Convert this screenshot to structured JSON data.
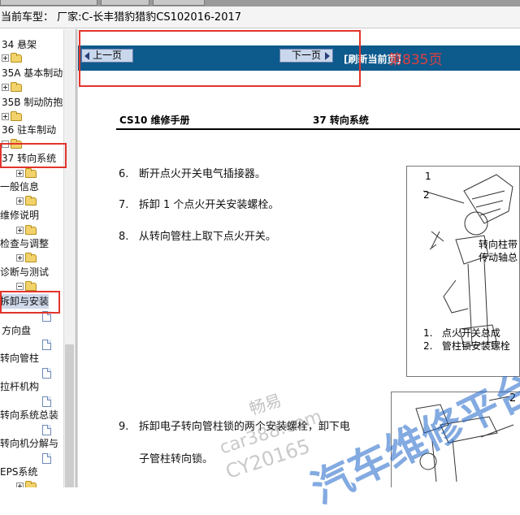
{
  "header": {
    "title": "当前车型： 厂家:C-长丰猎豹猎豹CS102016-2017"
  },
  "toolbar": {
    "prev_label": "上一页",
    "next_label": "下一页",
    "page_info_label": "[刷新当前页]",
    "page_info_value": "第835页"
  },
  "sidebar": {
    "items": [
      {
        "label": "34 悬架",
        "type": "folder"
      },
      {
        "label": "35A 基本制动",
        "type": "folder"
      },
      {
        "label": "35B 制动防抱",
        "type": "folder"
      },
      {
        "label": "36 驻车制动",
        "type": "folder"
      },
      {
        "label": "37 转向系统",
        "type": "folder"
      },
      {
        "label": "一般信息",
        "type": "folder"
      },
      {
        "label": "维修说明",
        "type": "folder"
      },
      {
        "label": "检查与调整",
        "type": "folder"
      },
      {
        "label": "诊断与测试",
        "type": "folder"
      },
      {
        "label": "拆卸与安装",
        "type": "folder"
      },
      {
        "label": "方向盘",
        "type": "page"
      },
      {
        "label": "转向管柱",
        "type": "page"
      },
      {
        "label": "拉杆机构",
        "type": "page"
      },
      {
        "label": "转向系统总装",
        "type": "page"
      },
      {
        "label": "转向机分解与",
        "type": "page"
      },
      {
        "label": "EPS系统",
        "type": "folder"
      }
    ]
  },
  "document": {
    "header_left": "CS10 维修手册",
    "header_center": "37 转向系统",
    "steps": [
      {
        "num": "6.",
        "text": "断开点火开关电气插接器。"
      },
      {
        "num": "7.",
        "text": "拆卸 1 个点火开关安装螺栓。"
      },
      {
        "num": "8.",
        "text": "从转向管柱上取下点火开关。"
      },
      {
        "num": "9.",
        "text": "拆卸电子转向管柱锁的两个安装螺栓，卸下电"
      },
      {
        "num": "",
        "text": "子管柱转向锁。"
      }
    ],
    "figure_callouts": {
      "n1": "1",
      "n2": "2",
      "side_line1": "转向柱带",
      "side_line2": "传动轴总",
      "legend1_num": "1.",
      "legend1_text": "点火开关总成",
      "legend2_num": "2.",
      "legend2_text": "管柱锁安装螺栓"
    },
    "figure2_callouts": {
      "n2": "2"
    }
  },
  "watermark": {
    "line1": "畅易",
    "line2": "car388.com",
    "line3": "CY20165",
    "line4": "汽车维修平台"
  }
}
